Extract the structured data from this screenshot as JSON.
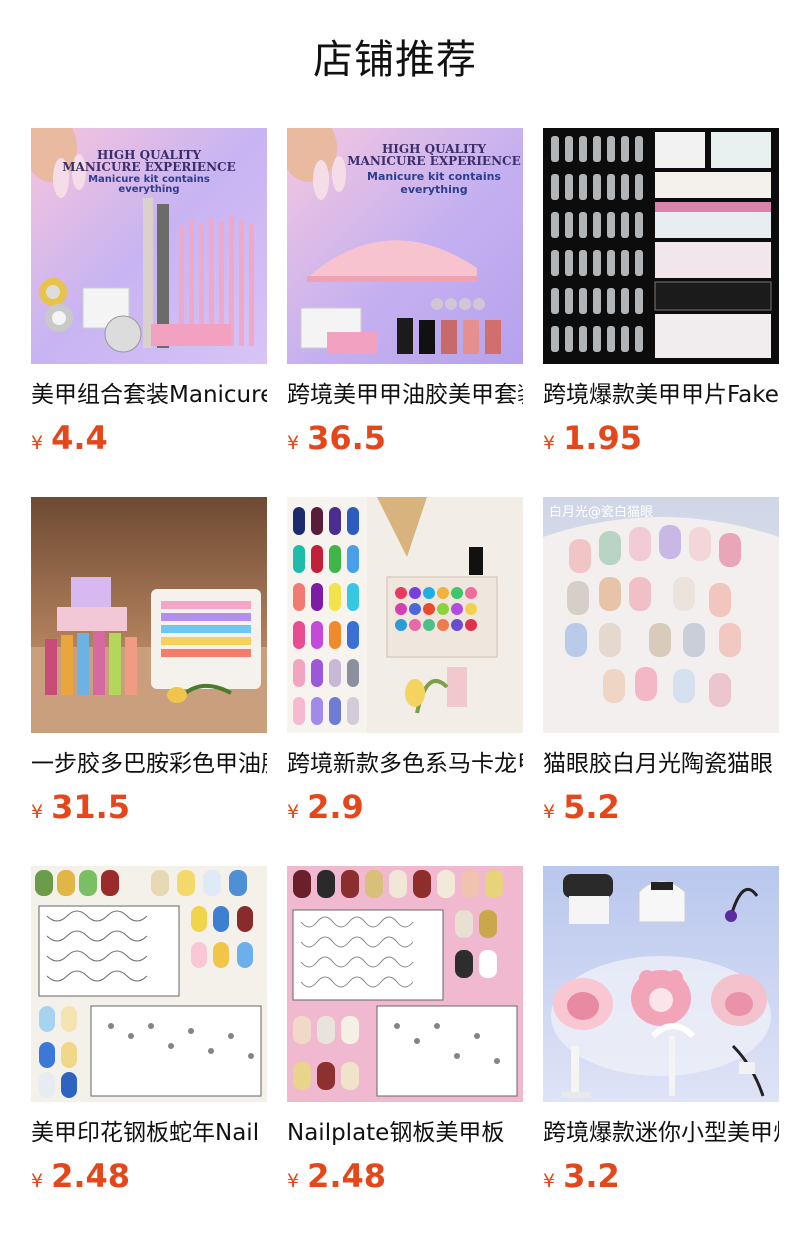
{
  "page": {
    "title": "店铺推荐"
  },
  "products": [
    {
      "name": "美甲组合套装Manicure kit",
      "currency": "¥",
      "price": "4.4",
      "banner": [
        "HIGH QUALITY",
        "MANICURE EXPERIENCE",
        "Manicure kit contains",
        "everything"
      ]
    },
    {
      "name": "跨境美甲甲油胶美甲套装",
      "currency": "¥",
      "price": "36.5",
      "banner": [
        "HIGH QUALITY",
        "MANICURE EXPERIENCE",
        "Manicure kit contains",
        "everything"
      ]
    },
    {
      "name": "跨境爆款美甲甲片Fake nails",
      "currency": "¥",
      "price": "1.95"
    },
    {
      "name": "一步胶多巴胺彩色甲油胶",
      "currency": "¥",
      "price": "31.5"
    },
    {
      "name": "跨境新款多色系马卡龙甲油胶",
      "currency": "¥",
      "price": "2.9"
    },
    {
      "name": "猫眼胶白月光陶瓷猫眼",
      "currency": "¥",
      "price": "5.2",
      "banner": [
        "白月光@瓷白猫眼"
      ]
    },
    {
      "name": "美甲印花钢板蛇年Nail plate",
      "currency": "¥",
      "price": "2.48"
    },
    {
      "name": "Nailplate钢板美甲板",
      "currency": "¥",
      "price": "2.48"
    },
    {
      "name": "跨境爆款迷你小型美甲灯",
      "currency": "¥",
      "price": "3.2"
    }
  ]
}
